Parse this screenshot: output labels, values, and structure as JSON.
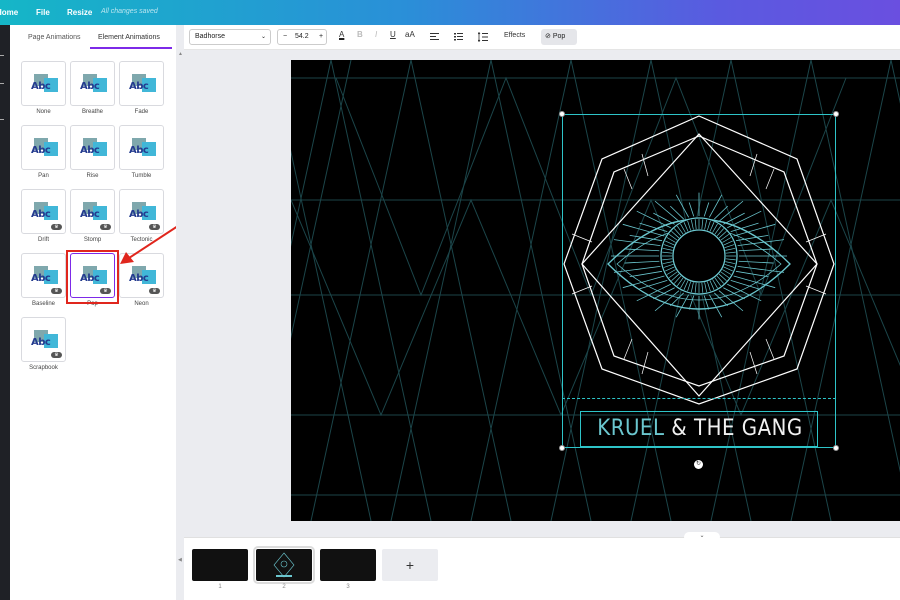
{
  "topbar": {
    "home": "Home",
    "file": "File",
    "resize": "Resize",
    "save_status": "All changes saved"
  },
  "panel": {
    "tabs": [
      {
        "label": "Page Animations",
        "active": false
      },
      {
        "label": "Element Animations",
        "active": true
      }
    ],
    "animations": [
      {
        "label": "None",
        "premium": false,
        "selected": false
      },
      {
        "label": "Breathe",
        "premium": false,
        "selected": false
      },
      {
        "label": "Fade",
        "premium": false,
        "selected": false
      },
      {
        "label": "Pan",
        "premium": false,
        "selected": false
      },
      {
        "label": "Rise",
        "premium": false,
        "selected": false
      },
      {
        "label": "Tumble",
        "premium": false,
        "selected": false
      },
      {
        "label": "Drift",
        "premium": true,
        "selected": false
      },
      {
        "label": "Stomp",
        "premium": true,
        "selected": false
      },
      {
        "label": "Tectonic",
        "premium": true,
        "selected": false
      },
      {
        "label": "Baseline",
        "premium": true,
        "selected": false
      },
      {
        "label": "Pop",
        "premium": true,
        "selected": true
      },
      {
        "label": "Neon",
        "premium": true,
        "selected": false
      },
      {
        "label": "Scrapbook",
        "premium": true,
        "selected": false
      }
    ],
    "thumb_text": "Abc",
    "crown_glyph": "♛"
  },
  "toolbar": {
    "font": "Badhorse",
    "font_size": "54.2",
    "minus": "−",
    "plus": "+",
    "text_color_glyph": "A",
    "bold": "B",
    "italic": "I",
    "underline": "U",
    "case": "aA",
    "effects": "Effects",
    "animation": "Pop"
  },
  "canvas": {
    "title_part1": "KRUEL",
    "title_part2": "& THE GANG",
    "accent_color": "#2ec4c8",
    "background_color": "#000000"
  },
  "pages": {
    "thumbs": [
      {
        "number": "1",
        "active": false
      },
      {
        "number": "2",
        "active": true
      },
      {
        "number": "3",
        "active": false
      }
    ],
    "add_label": "+"
  }
}
